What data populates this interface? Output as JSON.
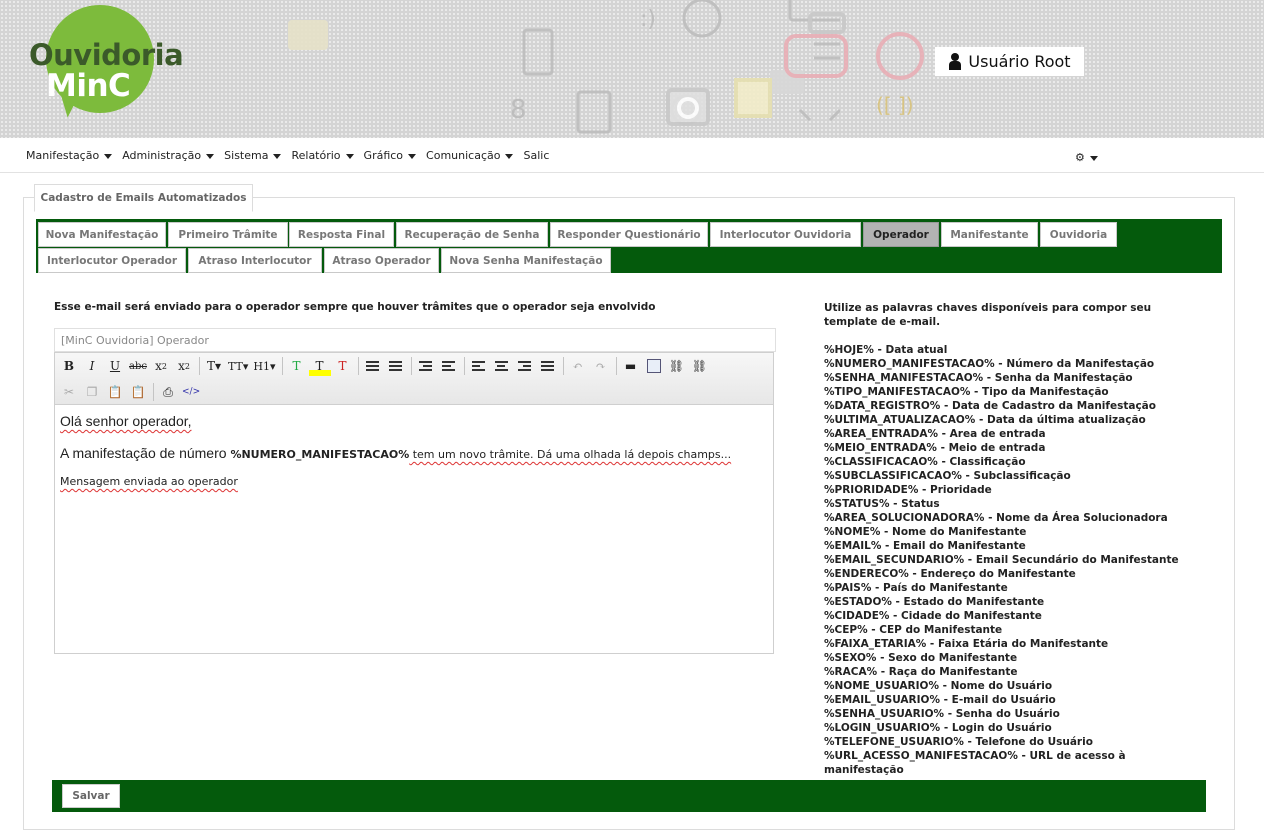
{
  "header": {
    "logo_line1": "Ouvidoria",
    "logo_line2": "MinC",
    "user_label": "Usuário Root",
    "user_icon": "user-icon"
  },
  "nav": {
    "items": [
      "Manifestação",
      "Administração",
      "Sistema",
      "Relatório",
      "Gráfico",
      "Comunicação",
      "Salic"
    ],
    "settings_icon": "gear-icon"
  },
  "panel": {
    "title": "Cadastro de Emails Automatizados"
  },
  "tabs": {
    "row1": [
      "Nova Manifestação",
      "Primeiro Trâmite",
      "Resposta Final",
      "Recuperação de Senha",
      "Responder Questionário",
      "Interlocutor Ouvidoria",
      "Operador",
      "Manifestante",
      "Ouvidoria"
    ],
    "row2": [
      "Interlocutor Operador",
      "Atraso Interlocutor",
      "Atraso Operador",
      "Nova Senha Manifestação"
    ],
    "active": "Operador",
    "colors": {
      "band": "#045a0c",
      "active_bg": "#b3b3b3"
    }
  },
  "form": {
    "description": "Esse e-mail será enviado para o operador sempre que houver trâmites que o operador seja envolvido",
    "subject_value": "[MinC Ouvidoria] Operador",
    "save_label": "Salvar"
  },
  "editor": {
    "line1": "Olá senhor operador,",
    "line2_prefix": "A manifestação de número ",
    "line2_keyword": "%NUMERO_MANIFESTACAO%",
    "line2_suffix": " tem um novo trâmite. Dá uma olhada lá depois champs...",
    "line3": "Mensagem enviada ao operador"
  },
  "keywords": {
    "intro": "Utilize as palavras chaves disponíveis para compor seu template de e-mail.",
    "items": [
      "%HOJE% - Data atual",
      "%NUMERO_MANIFESTACAO% - Número da Manifestação",
      "%SENHA_MANIFESTACAO% - Senha da Manifestação",
      "%TIPO_MANIFESTACAO% - Tipo da Manifestação",
      "%DATA_REGISTRO% - Data de Cadastro da Manifestação",
      "%ULTIMA_ATUALIZACAO% - Data da última atualização",
      "%AREA_ENTRADA% - Area de entrada",
      "%MEIO_ENTRADA% - Meio de entrada",
      "%CLASSIFICACAO% - Classificação",
      "%SUBCLASSIFICACAO% - Subclassificação",
      "%PRIORIDADE% - Prioridade",
      "%STATUS% - Status",
      "%AREA_SOLUCIONADORA% - Nome da Área Solucionadora",
      "%NOME% - Nome do Manifestante",
      "%EMAIL% - Email do Manifestante",
      "%EMAIL_SECUNDARIO% - Email Secundário do Manifestante",
      "%ENDERECO% - Endereço do Manifestante",
      "%PAIS% - País do Manifestante",
      "%ESTADO% - Estado do Manifestante",
      "%CIDADE% - Cidade do Manifestante",
      "%CEP% - CEP do Manifestante",
      "%FAIXA_ETARIA% - Faixa Etária do Manifestante",
      "%SEXO% - Sexo do Manifestante",
      "%RACA% - Raça do Manifestante",
      "%NOME_USUARIO% - Nome do Usuário",
      "%EMAIL_USUARIO% - E-mail do Usuário",
      "%SENHA_USUARIO% - Senha do Usuário",
      "%LOGIN_USUARIO% - Login do Usuário",
      "%TELEFONE_USUARIO% - Telefone do Usuário",
      "%URL_ACESSO_MANIFESTACAO% - URL de acesso à manifestação"
    ]
  }
}
